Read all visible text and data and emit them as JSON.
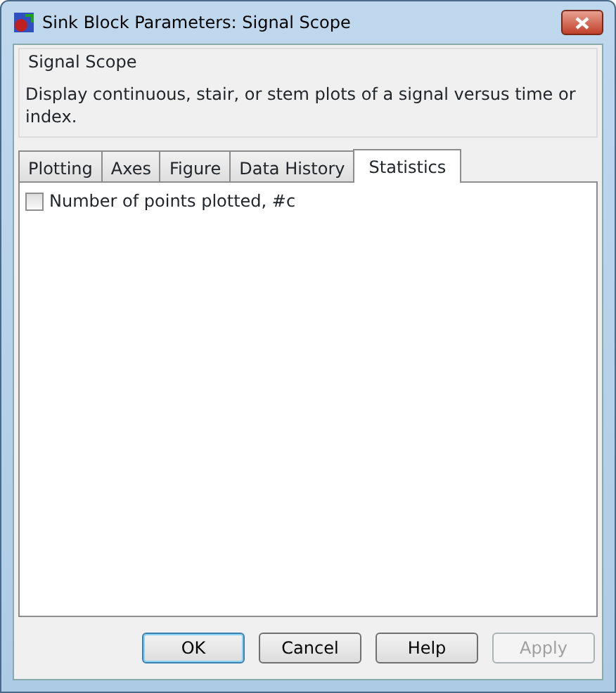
{
  "window": {
    "title": "Sink Block Parameters: Signal Scope"
  },
  "group": {
    "title": "Signal Scope",
    "description": "Display continuous, stair, or stem plots of a signal versus time or index."
  },
  "tabs": [
    {
      "label": "Plotting",
      "selected": false
    },
    {
      "label": "Axes",
      "selected": false
    },
    {
      "label": "Figure",
      "selected": false
    },
    {
      "label": "Data History",
      "selected": false
    },
    {
      "label": "Statistics",
      "selected": true
    }
  ],
  "options": [
    {
      "label": "Number of points plotted, #c",
      "checked": false
    }
  ],
  "buttons": [
    {
      "label": "OK",
      "default": true,
      "disabled": false
    },
    {
      "label": "Cancel",
      "default": false,
      "disabled": false
    },
    {
      "label": "Help",
      "default": false,
      "disabled": false
    },
    {
      "label": "Apply",
      "default": false,
      "disabled": true
    }
  ]
}
